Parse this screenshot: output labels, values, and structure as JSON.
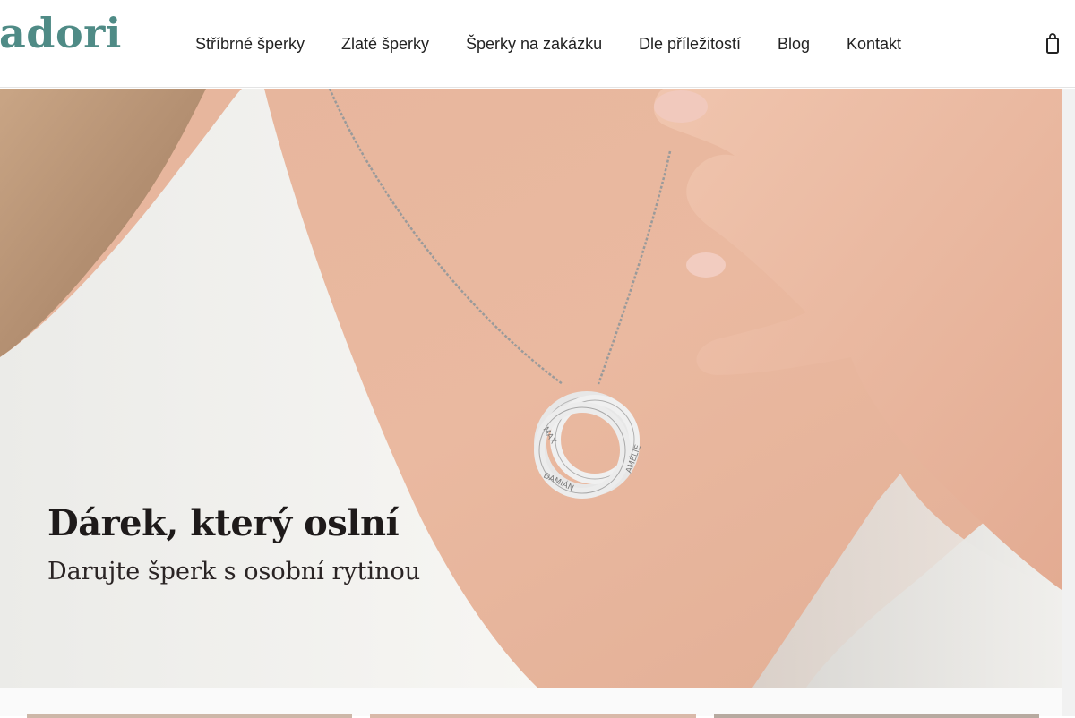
{
  "brand": {
    "logo_text": "adori",
    "color": "#4f8b86"
  },
  "nav": {
    "items": [
      {
        "label": "Stříbrné šperky"
      },
      {
        "label": "Zlaté šperky"
      },
      {
        "label": "Šperky na zakázku"
      },
      {
        "label": "Dle příležitostí"
      },
      {
        "label": "Blog"
      },
      {
        "label": "Kontakt"
      }
    ],
    "cart_icon": "shopping-bag-icon"
  },
  "hero": {
    "title": "Dárek, který oslní",
    "subtitle": "Darujte šperk s osobní rytinou",
    "pendant_engravings": [
      "MAX",
      "DAMIÁN",
      "AMÉLIE"
    ]
  }
}
